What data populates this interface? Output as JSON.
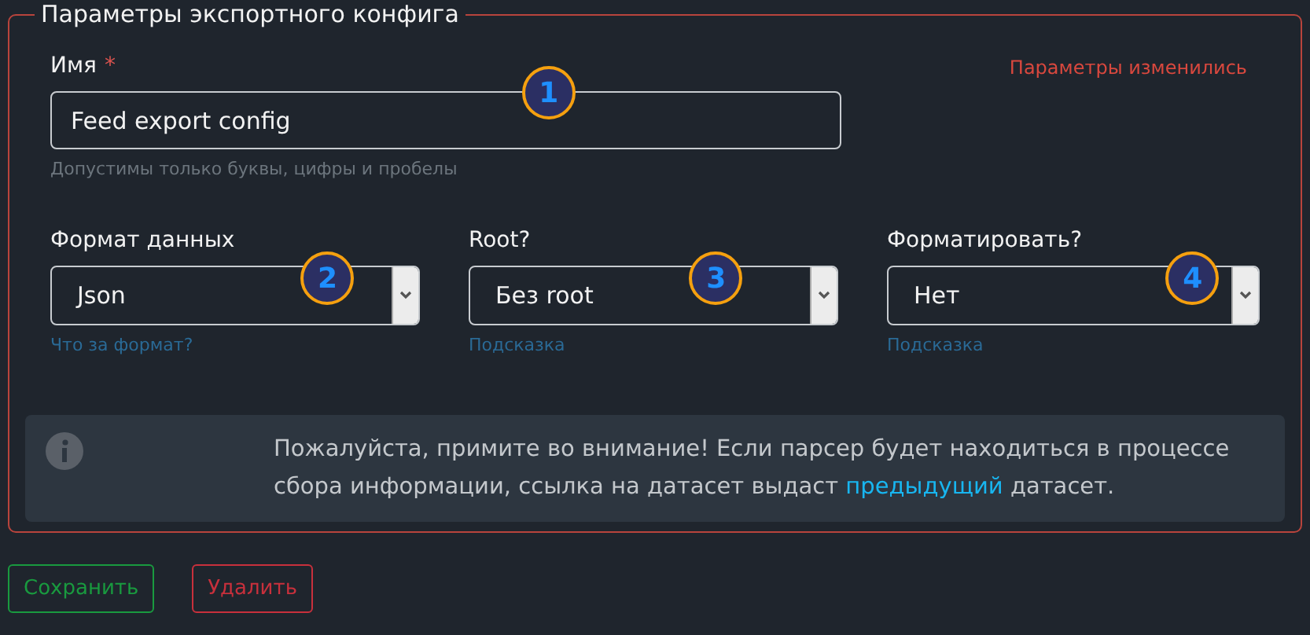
{
  "legend": "Параметры экспортного конфига",
  "name_field": {
    "label": "Имя",
    "required_mark": "*",
    "value": "Feed export config",
    "hint": "Допустимы только буквы, цифры и пробелы",
    "badge": "1"
  },
  "changed_notice": "Параметры изменились",
  "selects": [
    {
      "label": "Формат данных",
      "value": "Json",
      "hint": "Что за формат?",
      "badge": "2"
    },
    {
      "label": "Root?",
      "value": "Без root",
      "hint": "Подсказка",
      "badge": "3"
    },
    {
      "label": "Форматировать?",
      "value": "Нет",
      "hint": "Подсказка",
      "badge": "4"
    }
  ],
  "notice": {
    "text_before": "Пожалуйста, примите во внимание! Если парсер будет находиться в процессе сбора информации, ссылка на датасет выдаст",
    "link": "предыдущий",
    "text_after": "датасет."
  },
  "buttons": [
    {
      "kind": "save",
      "label": "Сохранить"
    },
    {
      "kind": "delete",
      "label": "Удалить"
    }
  ]
}
